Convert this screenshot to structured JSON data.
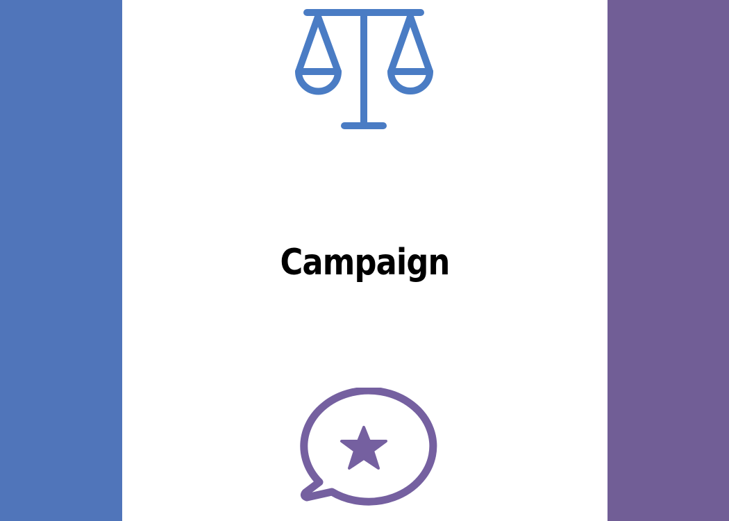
{
  "title": "Campaign",
  "colors": {
    "left_band": "#5075BA",
    "right_band": "#715E96",
    "scale_icon": "#4A7CC4",
    "chat_icon": "#7560A0",
    "background": "#FFFFFF",
    "title_text": "#000000"
  },
  "icons": {
    "top": "balance-scale-icon",
    "bottom": "chat-bubble-star-icon"
  }
}
